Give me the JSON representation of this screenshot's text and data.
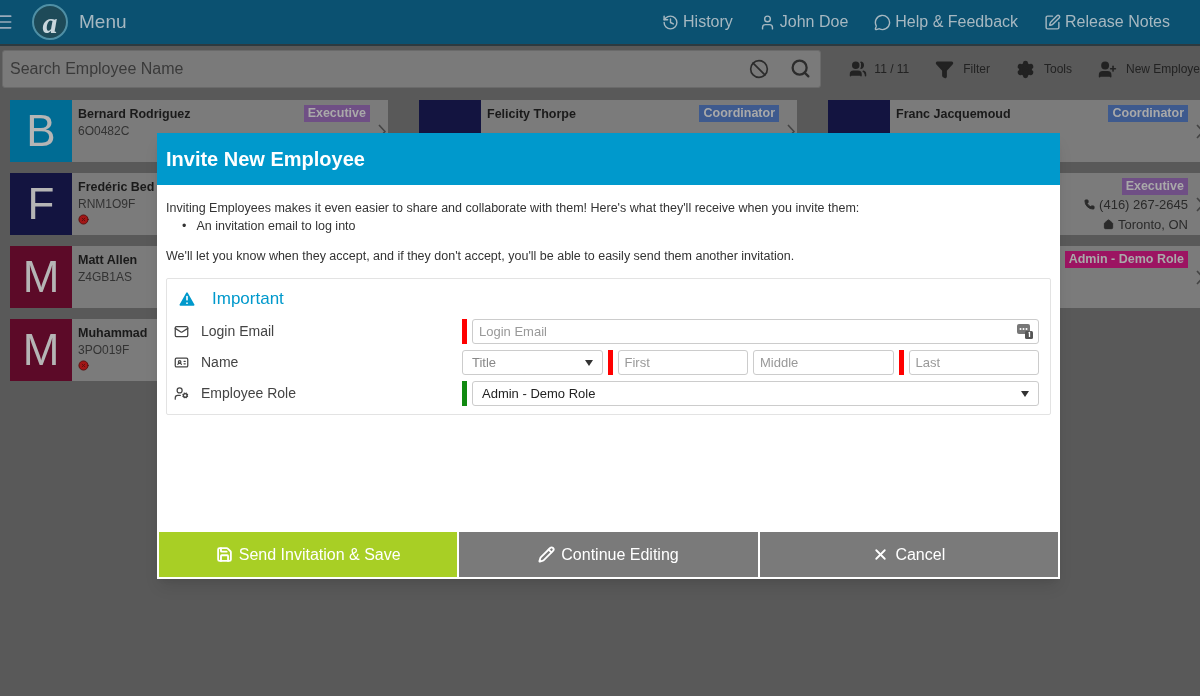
{
  "header": {
    "logo_text": "a",
    "menu_label": "Menu",
    "nav": [
      {
        "kind": "history",
        "label": "History"
      },
      {
        "kind": "user",
        "label": "John Doe"
      },
      {
        "kind": "help",
        "label": "Help & Feedback"
      },
      {
        "kind": "notes",
        "label": "Release Notes"
      }
    ]
  },
  "toolbar": {
    "search": {
      "placeholder": "Search Employee Name"
    },
    "count": "11 / 11",
    "actions": [
      {
        "kind": "filter",
        "label": "Filter"
      },
      {
        "kind": "tools",
        "label": "Tools"
      },
      {
        "kind": "new",
        "label": "New Employe"
      }
    ]
  },
  "employee_columns": [
    [
      {
        "initial": "B",
        "color": "#006c94",
        "name": "Bernard Rodriguez",
        "code": "6O0482C",
        "role": {
          "label": "Executive",
          "color": "#6f4f85"
        },
        "error": false,
        "arrow": true
      },
      {
        "initial": "F",
        "color": "#131440",
        "name": "Fredéric Bed",
        "code": "RNM1O9F",
        "error": true
      },
      {
        "initial": "M",
        "color": "#5c0a28",
        "name": "Matt Allen",
        "code": "Z4GB1AS",
        "error": false
      },
      {
        "initial": "M",
        "color": "#5c0a28",
        "name": "Muhammad",
        "code": "3PO019F",
        "error": true
      }
    ],
    [
      {
        "color": "#131440",
        "name": "Felicity Thorpe",
        "role": {
          "label": "Coordinator",
          "color": "#3e5a8e"
        },
        "arrow": true
      }
    ],
    [
      {
        "color": "#131440",
        "name": "Franc Jacquemoud",
        "role": {
          "label": "Coordinator",
          "color": "#3e5a8e"
        },
        "arrow": true
      },
      {
        "role": {
          "label": "Executive",
          "color": "#6f4f85"
        },
        "phone": "(416) 267-2645",
        "location": "Toronto, ON",
        "arrow": true
      },
      {
        "role": {
          "label": "Admin - Demo Role",
          "color": "#9c1462"
        },
        "arrow": true
      }
    ]
  ],
  "dialog": {
    "title": "Invite New Employee",
    "intro": "Inviting Employees makes it even easier to share and collaborate with them! Here's what they'll receive when you invite them:",
    "bullet": "•",
    "benefits": [
      "An invitation email to log into"
    ],
    "note": "We'll let you know when they accept, and if they don't accept, you'll be able to easily send them another invitation.",
    "section": {
      "title": "Important",
      "fields": [
        {
          "kind": "email",
          "label": "Login Email",
          "inputs": [
            {
              "kind": "text",
              "placeholder": "Login Email",
              "color": "#ff0000",
              "addon": true
            }
          ]
        },
        {
          "kind": "name",
          "label": "Name",
          "inputs": [
            {
              "kind": "select",
              "placeholder": "Title"
            },
            {
              "kind": "text",
              "placeholder": "First",
              "color": "#ff0000"
            },
            {
              "kind": "text",
              "placeholder": "Middle"
            },
            {
              "kind": "text",
              "placeholder": "Last",
              "color": "#ff0000"
            }
          ]
        },
        {
          "kind": "role",
          "label": "Employee Role",
          "inputs": [
            {
              "kind": "select",
              "value": "Admin - Demo Role",
              "color": "#118a11"
            }
          ]
        }
      ]
    },
    "buttons": [
      {
        "kind": "save",
        "label": "Send Invitation & Save"
      },
      {
        "kind": "edit",
        "label": "Continue Editing"
      },
      {
        "kind": "cancel",
        "label": "Cancel"
      }
    ]
  }
}
